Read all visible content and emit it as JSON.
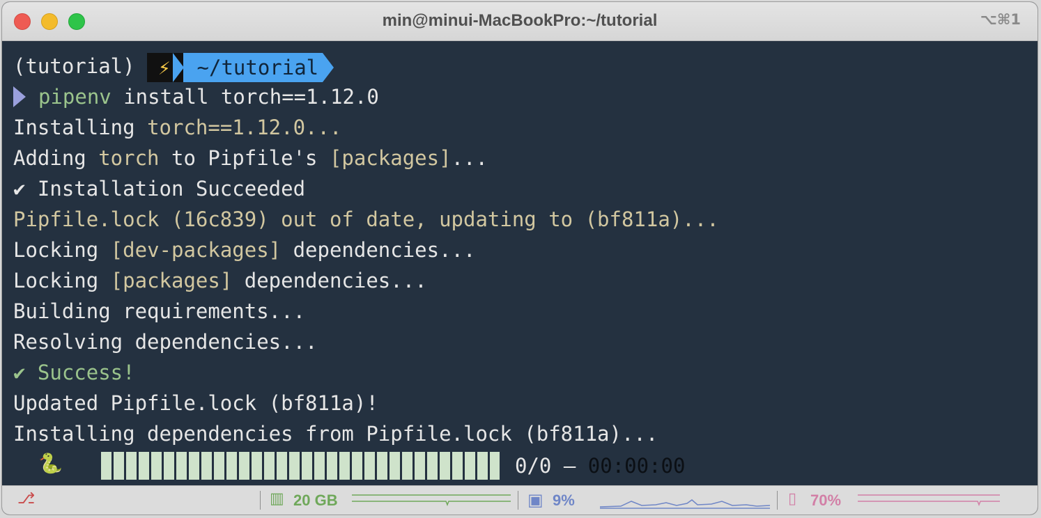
{
  "window": {
    "title": "min@minui-MacBookPro:~/tutorial",
    "shortcut": "⌥⌘1"
  },
  "prompt": {
    "env": "(tutorial)",
    "bolt": "⚡",
    "path": "~/tutorial"
  },
  "command": {
    "tool": "pipenv",
    "args": " install torch==1.12.0"
  },
  "output": {
    "l1_a": "Installing ",
    "l1_b": "torch==1.12.0...",
    "l2_a": "Adding ",
    "l2_b": "torch",
    "l2_c": " to Pipfile's ",
    "l2_d": "[packages]",
    "l2_e": "...",
    "l3": "✔ Installation Succeeded",
    "l4": "Pipfile.lock (16c839) out of date, updating to (bf811a)...",
    "l5_a": "Locking ",
    "l5_b": "[dev-packages]",
    "l5_c": " dependencies...",
    "l6_a": "Locking ",
    "l6_b": "[packages]",
    "l6_c": " dependencies...",
    "l7": "Building requirements...",
    "l8": "Resolving dependencies...",
    "l9": "✔ Success!",
    "l10": "Updated Pipfile.lock (bf811a)!",
    "l11": "Installing dependencies from Pipfile.lock (bf811a)..."
  },
  "progress": {
    "icon": "🐍",
    "fraction": 1.0,
    "count": "0/0 – ",
    "elapsed": "00:00:00"
  },
  "statusbar": {
    "memory": "20 GB",
    "cpu": "9%",
    "battery": "70%",
    "colors": {
      "memory": "#6fa85a",
      "cpu": "#6f86c7",
      "battery": "#d27fa6",
      "branch": "#c94b4b"
    }
  }
}
